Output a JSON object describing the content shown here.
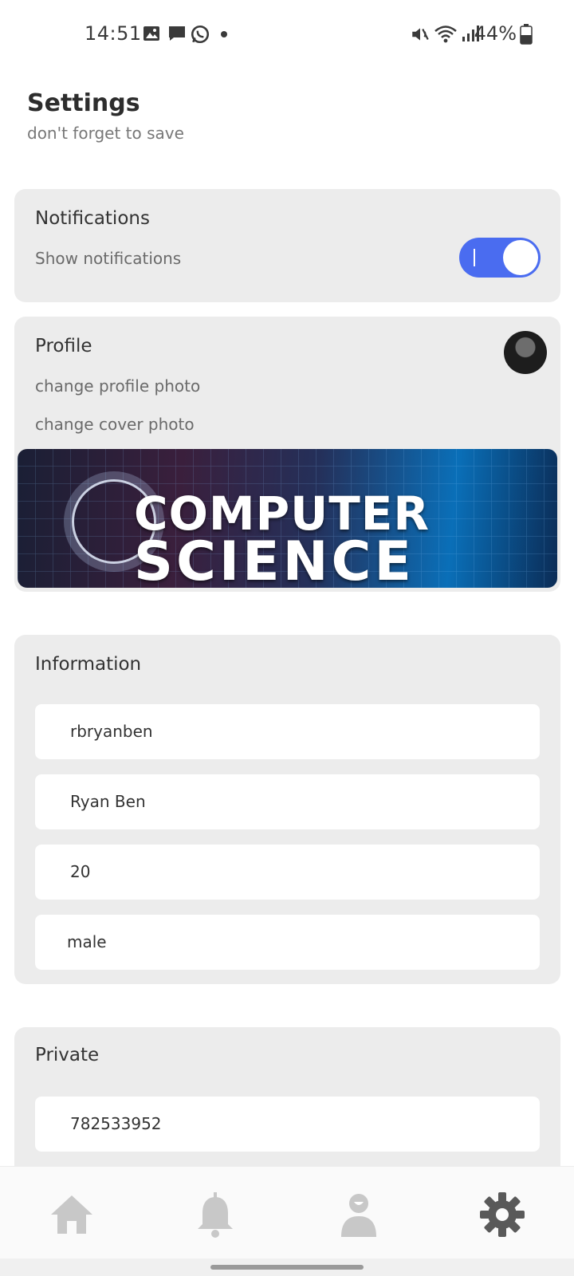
{
  "status_bar": {
    "time": "14:51",
    "battery": "44%"
  },
  "header": {
    "title": "Settings",
    "subtitle": "don't forget to save"
  },
  "notifications": {
    "title": "Notifications",
    "label": "Show notifications",
    "enabled": true
  },
  "profile": {
    "title": "Profile",
    "change_photo": "change profile photo",
    "change_cover": "change cover photo",
    "cover_text_line1": "COMPUTER",
    "cover_text_line2": "SCIENCE"
  },
  "information": {
    "title": "Information",
    "fields": [
      "rbryanben",
      "Ryan Ben",
      "20",
      "male"
    ]
  },
  "private": {
    "title": "Private",
    "fields": [
      "782533952"
    ]
  },
  "nav": {
    "items": [
      "home-icon",
      "bell-icon",
      "profile-icon",
      "settings-icon"
    ],
    "active": "settings-icon"
  },
  "colors": {
    "accent": "#4a6cf0",
    "card": "#ececec",
    "nav_icon": "#c8c8c8",
    "nav_active": "#595959"
  }
}
